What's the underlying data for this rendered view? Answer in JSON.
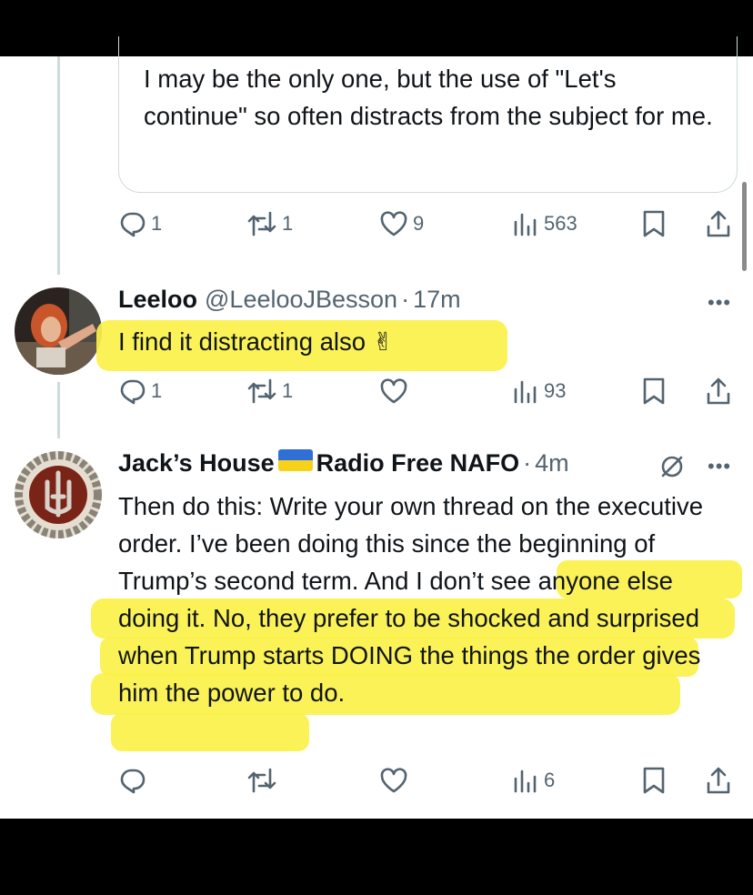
{
  "quoted": {
    "text": "I may be the only one, but the use of \"Let's continue\" so often distracts from the subject for me."
  },
  "main_actions": {
    "reply_count": "1",
    "repost_count": "1",
    "like_count": "9",
    "views_count": "563"
  },
  "reply1": {
    "name": "Leeloo",
    "handle": "@LeelooJBesson",
    "separator": "·",
    "time": "17m",
    "text": "I find it distracting also ✌",
    "actions": {
      "reply_count": "1",
      "repost_count": "1",
      "like_count": "",
      "views_count": "93"
    }
  },
  "reply2": {
    "name_part1": "Jack’s House",
    "name_part2": "Radio Free NAFO",
    "separator": "·",
    "time": "4m",
    "text": "Then do this: Write your own thread on the executive order. I’ve been doing this since the beginning of Trump’s second term. And I don’t see anyone else doing it. No, they prefer to be shocked and surprised when Trump starts DOING the things the order gives him the power to do.",
    "actions": {
      "reply_count": "",
      "repost_count": "",
      "like_count": "",
      "views_count": "6"
    }
  },
  "more_glyph": "•••",
  "colors": {
    "highlight": "#fbf14a",
    "muted": "#536471",
    "border": "#cfd9de"
  },
  "icons": [
    "reply-icon",
    "repost-icon",
    "like-icon",
    "views-icon",
    "bookmark-icon",
    "share-icon",
    "more-icon",
    "edited-icon"
  ]
}
